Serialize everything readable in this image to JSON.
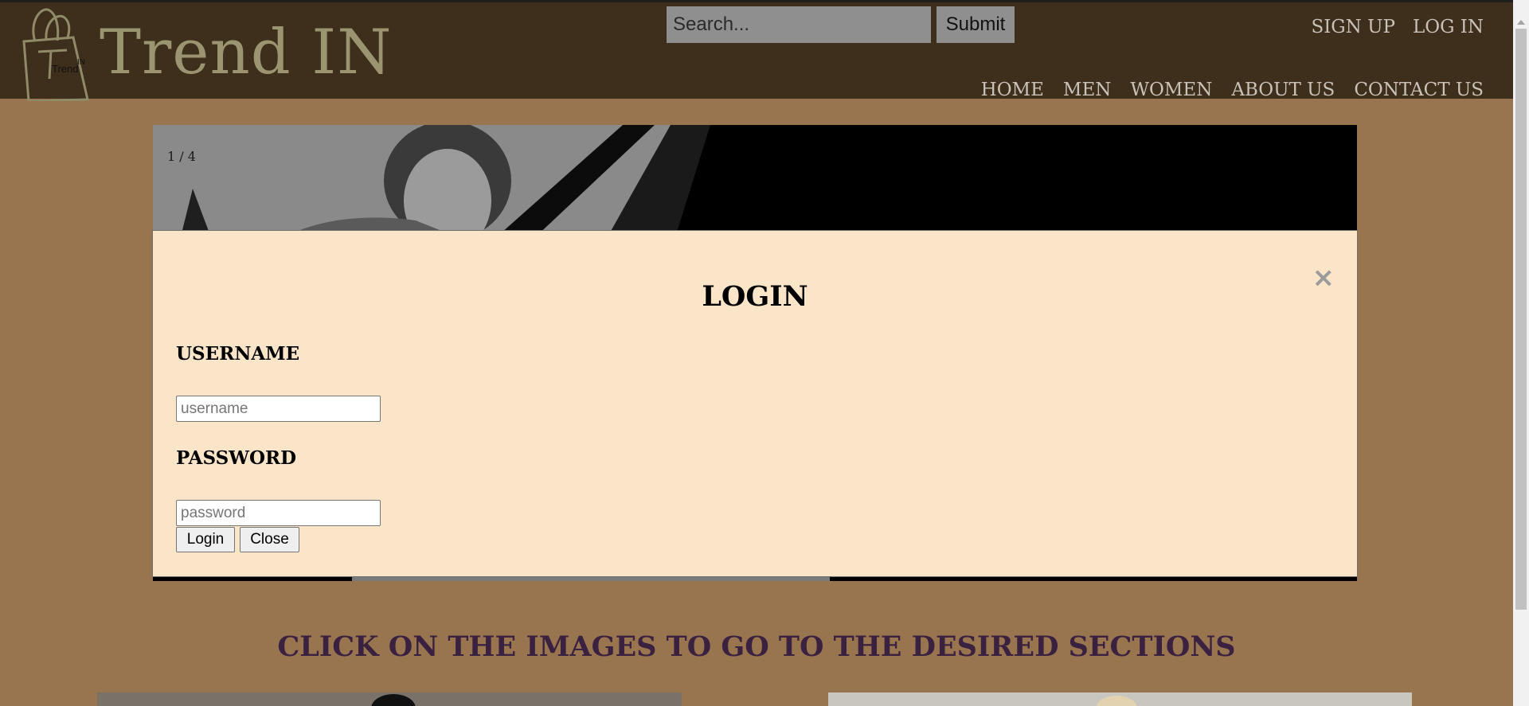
{
  "header": {
    "brand": "Trend IN",
    "logo_text": "Trend",
    "logo_superscript": "IN",
    "search_placeholder": "Search...",
    "submit_label": "Submit",
    "auth_links": [
      "SIGN UP",
      "LOG IN"
    ],
    "nav": [
      "HOME",
      "MEN",
      "WOMEN",
      "ABOUT US",
      "CONTACT US"
    ]
  },
  "slideshow": {
    "counter": "1 / 4"
  },
  "login_modal": {
    "close_symbol": "×",
    "title": "LOGIN",
    "username_label": "USERNAME",
    "username_placeholder": "username",
    "password_label": "PASSWORD",
    "password_placeholder": "password",
    "login_button": "Login",
    "close_button": "Close"
  },
  "sections_heading": "CLICK ON THE IMAGES TO GO TO THE DESIRED SECTIONS",
  "colors": {
    "page_bg": "#98754f",
    "header_bg": "#3d2f1b",
    "modal_bg": "#fae5c9",
    "brand": "#9a9570",
    "heading": "#3b2140"
  }
}
